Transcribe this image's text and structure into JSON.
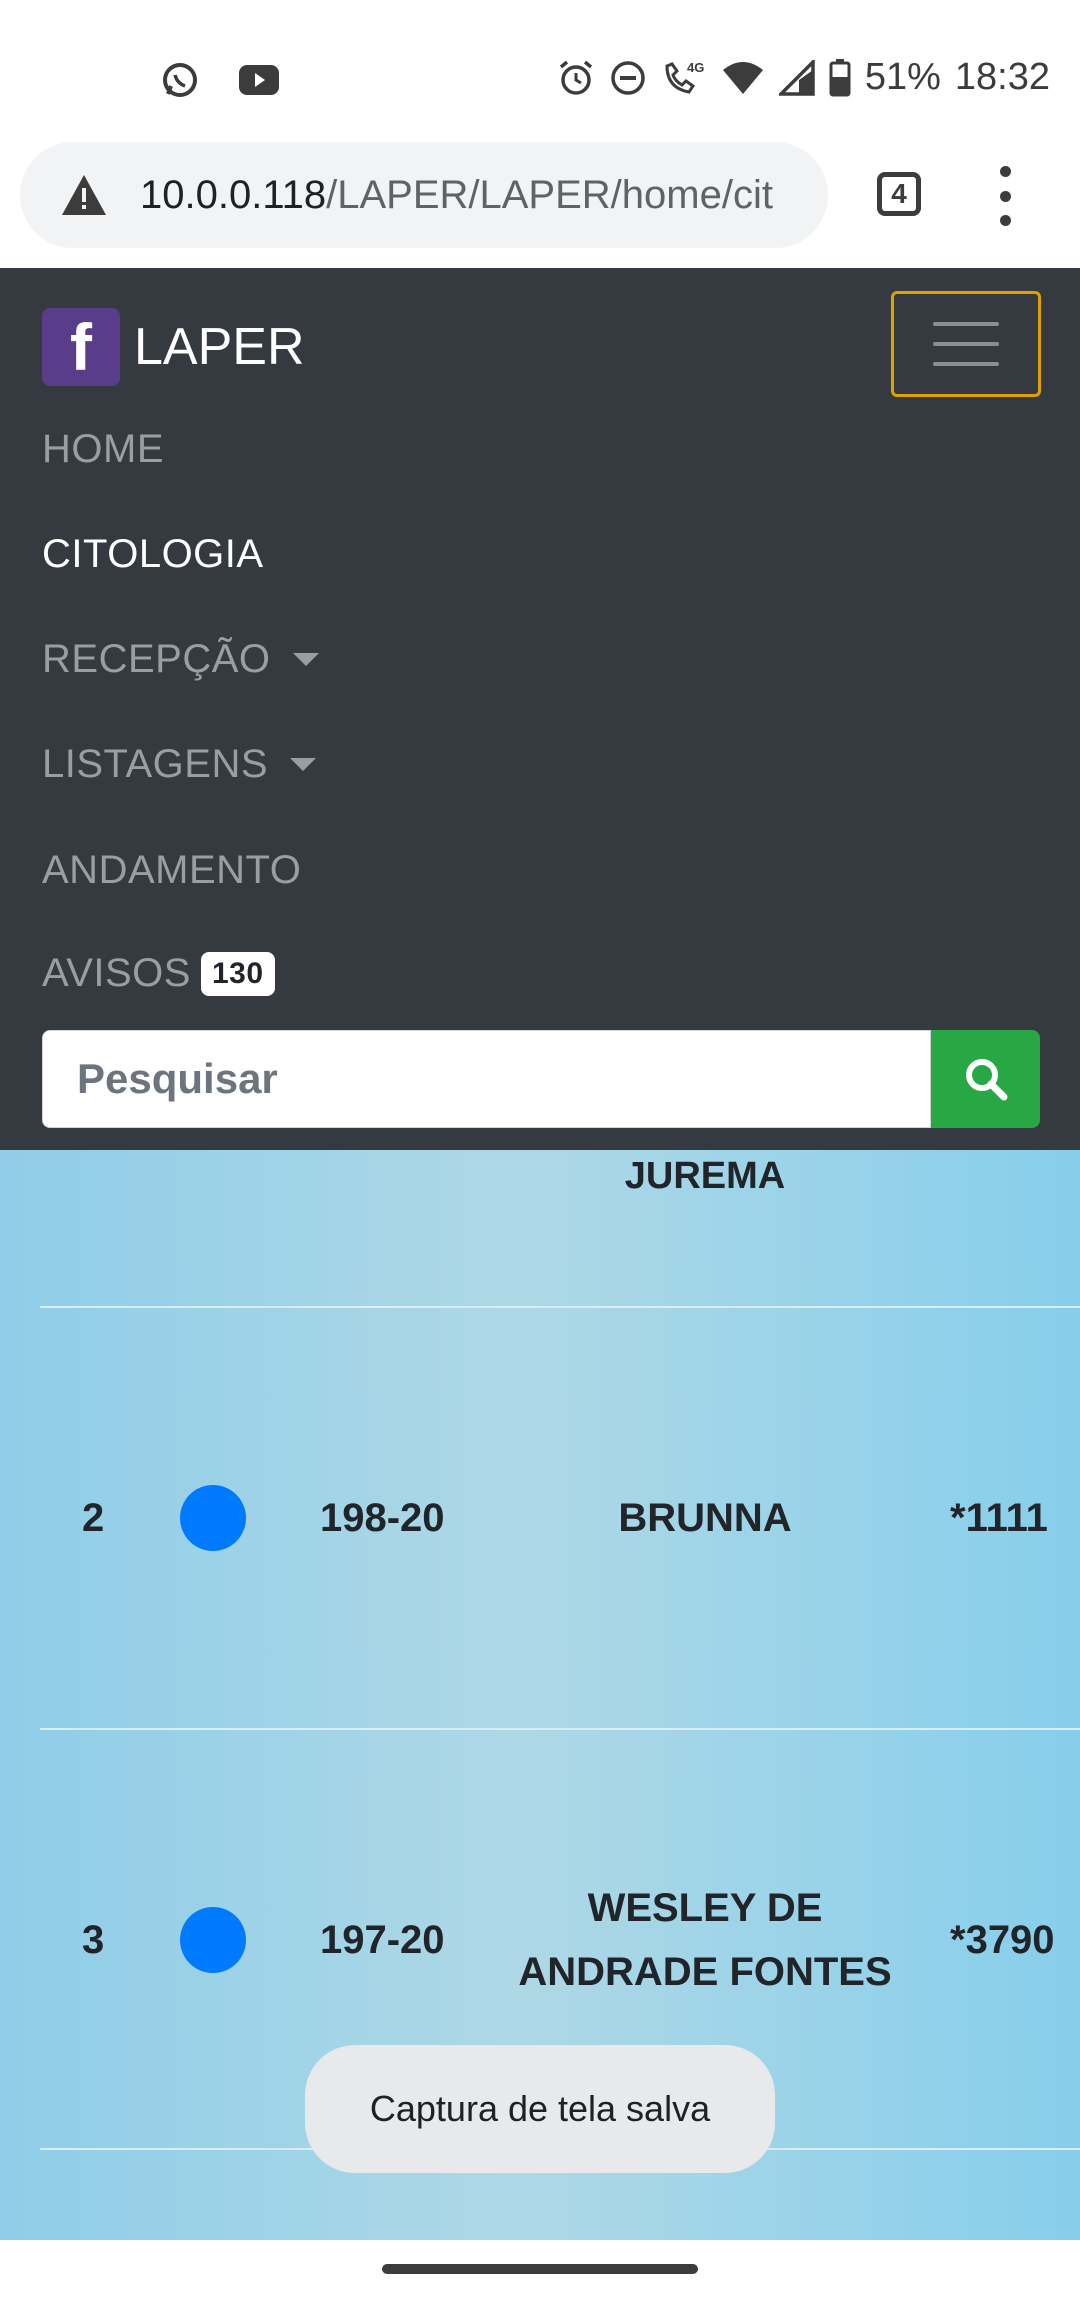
{
  "status_bar": {
    "left_icons": [
      "whatsapp-icon",
      "youtube-icon"
    ],
    "right_icons": [
      "alarm-icon",
      "dnd-icon",
      "volte-4g-icon",
      "wifi-icon",
      "signal-icon",
      "battery-icon"
    ],
    "network_label": "4G",
    "battery": "51%",
    "time": "18:32"
  },
  "browser": {
    "url_host": "10.0.0.118",
    "url_path": "/LAPER/LAPER/home/cit",
    "tab_count": "4"
  },
  "navbar": {
    "brand_logo_letter": "f",
    "brand_name": "LAPER",
    "items": [
      {
        "label": "HOME",
        "active": false
      },
      {
        "label": "CITOLOGIA",
        "active": true
      },
      {
        "label": "RECEPÇÃO",
        "dropdown": true
      },
      {
        "label": "LISTAGENS",
        "dropdown": true
      },
      {
        "label": "ANDAMENTO"
      },
      {
        "label": "AVISOS",
        "badge": "130"
      }
    ],
    "search_placeholder": "Pesquisar"
  },
  "table": {
    "partial_name": "JUREMA",
    "rows": [
      {
        "num": "2",
        "status_color": "#007bff",
        "code": "198-20",
        "name": "BRUNNA",
        "ext": "*1111"
      },
      {
        "num": "3",
        "status_color": "#007bff",
        "code": "197-20",
        "name": "WESLEY DE ANDRADE FONTES",
        "ext": "*3790"
      }
    ]
  },
  "toast": "Captura de tela salva",
  "colors": {
    "navbar_bg": "#343a40",
    "brand_logo_bg": "#5a3d8a",
    "search_button": "#28a745",
    "toggler_border": "#e0a000",
    "status_dot": "#007bff"
  }
}
